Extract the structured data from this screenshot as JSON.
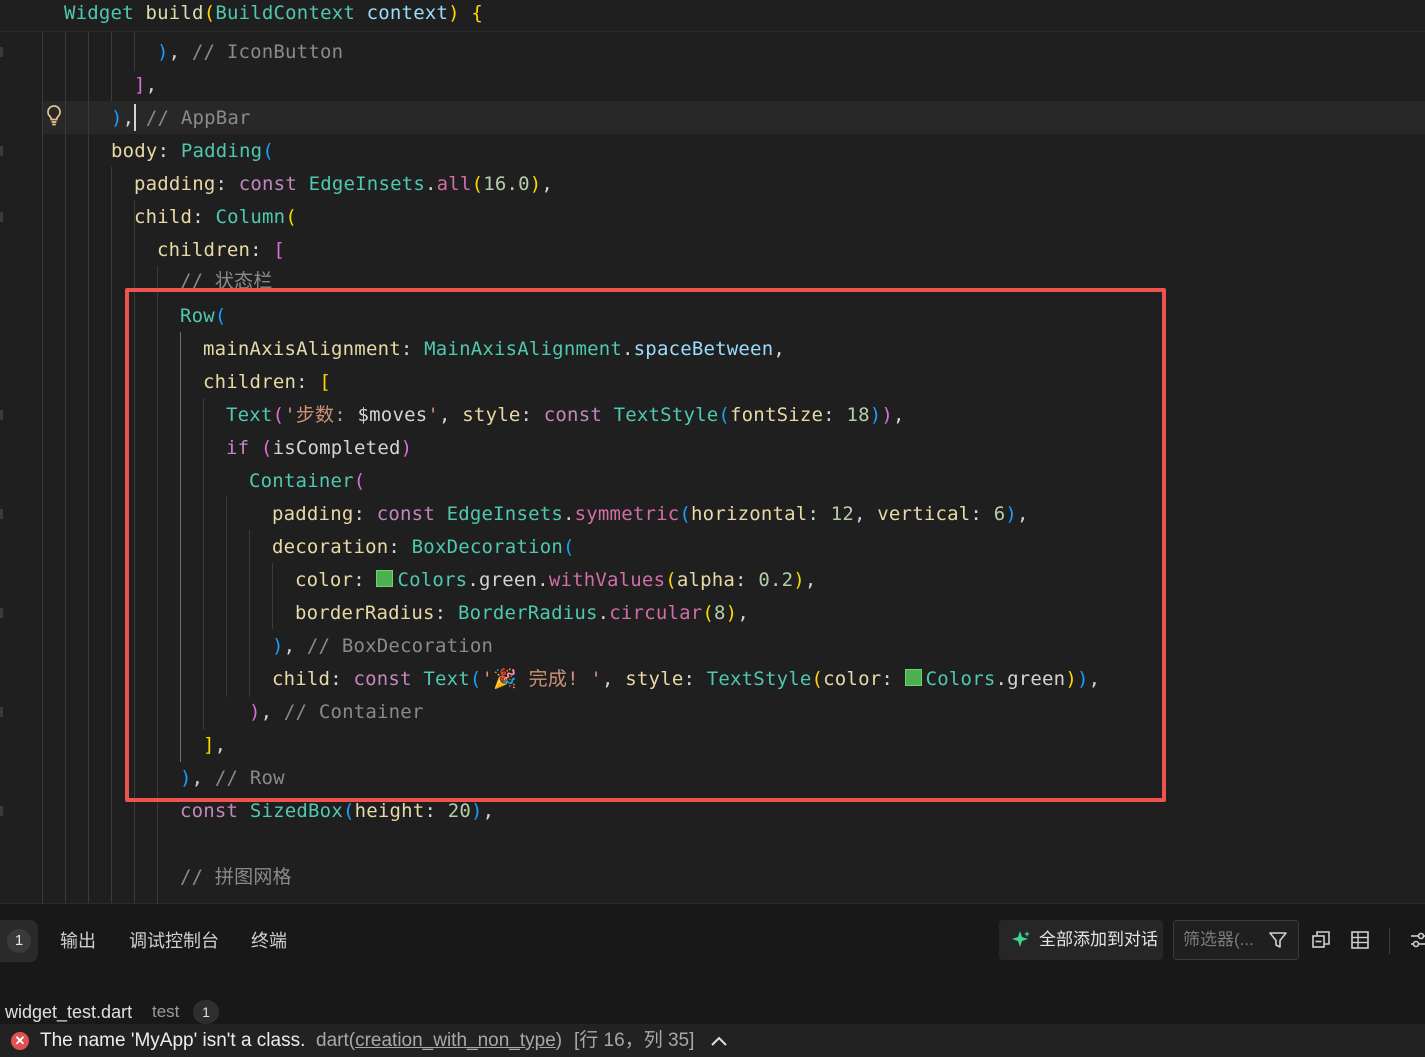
{
  "editor": {
    "sticky_line": {
      "kw": "Widget",
      "fn": "build",
      "type": "BuildContext",
      "arg": "context",
      "tail": ") {"
    },
    "lines": {
      "l1_comment": "// IconButton",
      "l3_comment": "// AppBar",
      "l4_body": "body",
      "l4_padding": "Padding",
      "l5_padding": "padding",
      "l5_const": "const",
      "l5_edge": "EdgeInsets",
      "l5_all": "all",
      "l5_num": "16.0",
      "l6_child": "child",
      "l6_column": "Column",
      "l7_children": "children",
      "l8_comment": "// 状态栏",
      "l9_row": "Row",
      "l10_maa": "mainAxisAlignment",
      "l10_type": "MainAxisAlignment",
      "l10_val": "spaceBetween",
      "l11_children": "children",
      "l12_text": "Text",
      "l12_str1": "'步数: ",
      "l12_var": "$moves",
      "l12_str2": "'",
      "l12_style": "style",
      "l12_const": "const",
      "l12_ts": "TextStyle",
      "l12_fs": "fontSize",
      "l12_num": "18",
      "l13_if": "if",
      "l13_var": "isCompleted",
      "l14_container": "Container",
      "l15_padding": "padding",
      "l15_const": "const",
      "l15_edge": "EdgeInsets",
      "l15_sym": "symmetric",
      "l15_h": "horizontal",
      "l15_hn": "12",
      "l15_v": "vertical",
      "l15_vn": "6",
      "l16_decoration": "decoration",
      "l16_bd": "BoxDecoration",
      "l17_color": "color",
      "l17_colors": "Colors",
      "l17_green": "green",
      "l17_wv": "withValues",
      "l17_alpha": "alpha",
      "l17_num": "0.2",
      "l18_br": "borderRadius",
      "l18_type": "BorderRadius",
      "l18_circ": "circular",
      "l18_num": "8",
      "l19_comment": "// BoxDecoration",
      "l20_child": "child",
      "l20_const": "const",
      "l20_text": "Text",
      "l20_str": "'🎉 完成! '",
      "l20_style": "style",
      "l20_ts": "TextStyle",
      "l20_color": "color",
      "l20_colors": "Colors",
      "l20_green": "green",
      "l21_comment": "// Container",
      "l23_comment": "// Row",
      "l24_const": "const",
      "l24_sb": "SizedBox",
      "l24_h": "height",
      "l24_num": "20",
      "l26_comment": "// 拼图网格"
    },
    "swatch_color": "#4caf50",
    "highlight_color": "#ef5350"
  },
  "panel": {
    "problems_count": "1",
    "tabs": [
      "输出",
      "调试控制台",
      "终端"
    ],
    "add_all_label": "全部添加到对话",
    "filter_placeholder": "筛选器(...",
    "file": {
      "name": "widget_test.dart",
      "dir": "test",
      "count": "1"
    },
    "error": {
      "message": "The name 'MyApp' isn't a class.",
      "source": "dart",
      "code": "creation_with_non_type",
      "position": "[行 16，列 35]"
    }
  }
}
